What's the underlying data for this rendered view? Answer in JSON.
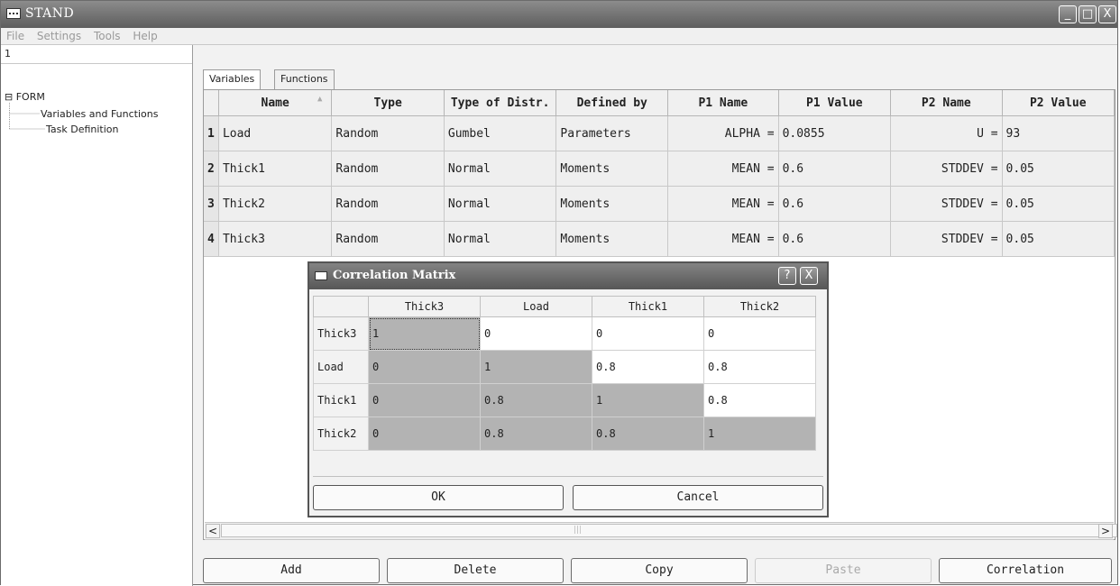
{
  "window": {
    "title": "STAND",
    "controls": [
      "_",
      "□",
      "X"
    ]
  },
  "menu": [
    "File",
    "Settings",
    "Tools",
    "Help"
  ],
  "left_pane": {
    "header": "1",
    "tree": [
      {
        "label": "FORM",
        "expander": "⊟"
      },
      {
        "label": "Variables and Functions"
      },
      {
        "label": "Task Definition"
      }
    ]
  },
  "tabs": [
    {
      "label": "Variables",
      "active": true
    },
    {
      "label": "Functions",
      "active": false
    }
  ],
  "grid": {
    "columns": [
      "Name",
      "Type",
      "Type of Distr.",
      "Defined by",
      "P1 Name",
      "P1 Value",
      "P2 Name",
      "P2 Value"
    ],
    "sort_indicator": "▲",
    "rows": [
      {
        "num": "1",
        "cells": [
          "Load",
          "Random",
          "Gumbel",
          "Parameters",
          "ALPHA =",
          "0.0855",
          "U =",
          "93"
        ]
      },
      {
        "num": "2",
        "cells": [
          "Thick1",
          "Random",
          "Normal",
          "Moments",
          "MEAN =",
          "0.6",
          "STDDEV =",
          "0.05"
        ]
      },
      {
        "num": "3",
        "cells": [
          "Thick2",
          "Random",
          "Normal",
          "Moments",
          "MEAN =",
          "0.6",
          "STDDEV =",
          "0.05"
        ]
      },
      {
        "num": "4",
        "cells": [
          "Thick3",
          "Random",
          "Normal",
          "Moments",
          "MEAN =",
          "0.6",
          "STDDEV =",
          "0.05"
        ]
      }
    ]
  },
  "scrollbar": {
    "left": "<",
    "right": ">",
    "grip": "|||"
  },
  "buttons": [
    "Add",
    "Delete",
    "Copy",
    "Paste",
    "Correlation"
  ],
  "dialog": {
    "title": "Correlation Matrix",
    "help": "?",
    "close": "X",
    "headers": [
      "Thick3",
      "Load",
      "Thick1",
      "Thick2"
    ],
    "rows": [
      {
        "label": "Thick3",
        "values": [
          "1",
          "0",
          "0",
          "0"
        ]
      },
      {
        "label": "Load",
        "values": [
          "0",
          "1",
          "0.8",
          "0.8"
        ]
      },
      {
        "label": "Thick1",
        "values": [
          "0",
          "0.8",
          "1",
          "0.8"
        ]
      },
      {
        "label": "Thick2",
        "values": [
          "0",
          "0.8",
          "0.8",
          "1"
        ]
      }
    ],
    "ok": "OK",
    "cancel": "Cancel"
  }
}
